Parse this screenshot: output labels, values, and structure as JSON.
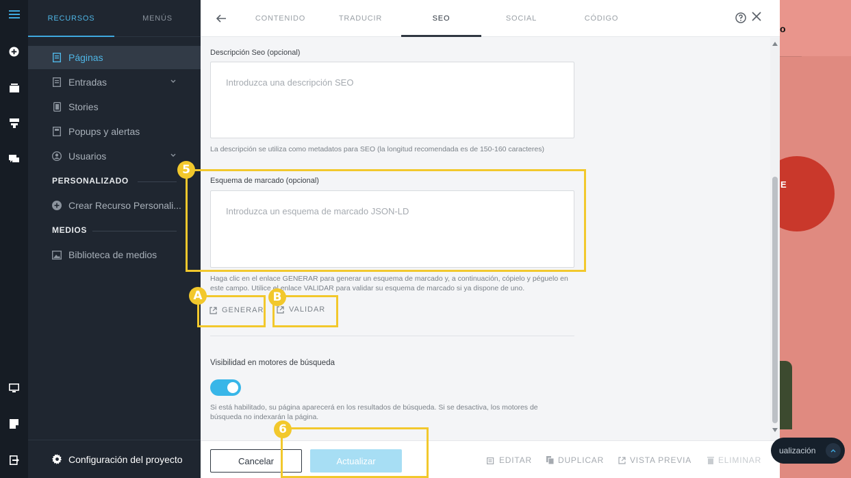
{
  "sidebar": {
    "tabs": [
      "RECURSOS",
      "MENÚS"
    ],
    "items": [
      {
        "label": "Páginas"
      },
      {
        "label": "Entradas"
      },
      {
        "label": "Stories"
      },
      {
        "label": "Popups y alertas"
      },
      {
        "label": "Usuarios"
      }
    ],
    "section_custom": "PERSONALIZADO",
    "custom_item": "Crear Recurso Personali...",
    "section_media": "MEDIOS",
    "media_item": "Biblioteca de medios",
    "config": "Configuración del proyecto"
  },
  "tabs": [
    "CONTENIDO",
    "TRADUCIR",
    "SEO",
    "SOCIAL",
    "CÓDIGO"
  ],
  "seo": {
    "desc_label": "Descripción Seo (opcional)",
    "desc_placeholder": "Introduzca una descripción SEO",
    "desc_help": "La descripción se utiliza como metadatos para SEO (la longitud recomendada es de 150-160 caracteres)",
    "schema_label": "Esquema de marcado (opcional)",
    "schema_placeholder": "Introduzca un esquema de marcado JSON-LD",
    "schema_help": "Haga clic en el enlace GENERAR para generar un esquema de marcado y, a continuación, cópielo y péguelo en este campo. Utilice el enlace VALIDAR para validar su esquema de marcado si ya dispone de uno.",
    "generate": "GENERAR",
    "validate": "VALIDAR",
    "visibility_label": "Visibilidad en motores de búsqueda",
    "visibility_help": "Si está habilitado, su página aparecerá en los resultados de búsqueda. Si se desactiva, los motores de búsqueda no indexarán la página."
  },
  "footer": {
    "cancel": "Cancelar",
    "update": "Actualizar",
    "edit": "EDITAR",
    "duplicate": "DUPLICAR",
    "preview": "VISTA PREVIA",
    "delete": "ELIMINAR"
  },
  "annotations": {
    "b5": "5",
    "bA": "A",
    "bB": "B",
    "b6": "6"
  },
  "preview": {
    "pill_label": "ualización",
    "circle_text": "E",
    "logo_frag": "o"
  },
  "colors": {
    "accent": "#3fa9df",
    "highlight": "#f2c82c",
    "toggle": "#38b6e8",
    "update_button": "#a7def4"
  }
}
